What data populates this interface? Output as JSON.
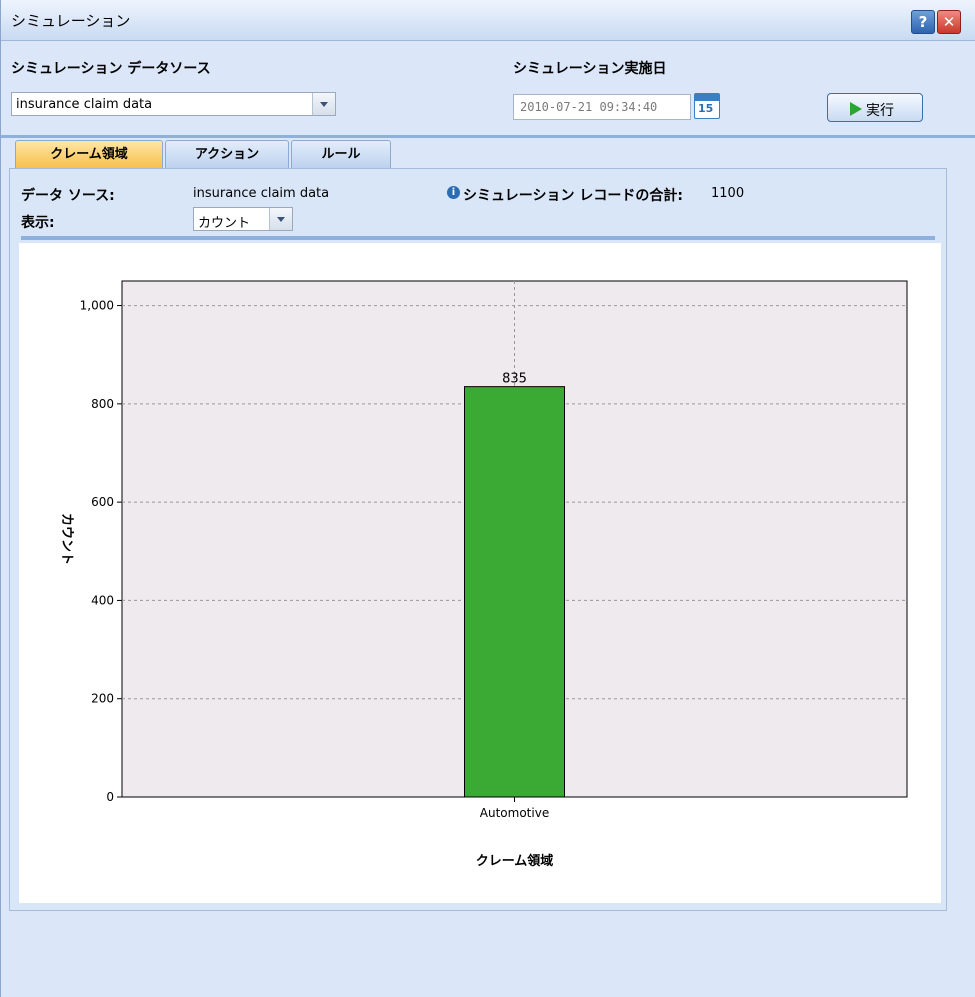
{
  "window": {
    "title": "シミュレーション",
    "help_label": "?",
    "close_label": "✕"
  },
  "datasource_section": {
    "label": "シミュレーション データソース",
    "selected": "insurance claim data"
  },
  "run_date_section": {
    "label": "シミュレーション実施日",
    "value": "2010-07-21 09:34:40",
    "calendar_day": "15"
  },
  "run_button": {
    "label": "実行"
  },
  "tabs": [
    {
      "label": "クレーム領域",
      "active": true
    },
    {
      "label": "アクション",
      "active": false
    },
    {
      "label": "ルール",
      "active": false
    }
  ],
  "panel": {
    "datasource_label": "データ ソース:",
    "datasource_value": "insurance claim data",
    "total_label": "シミュレーション レコードの合計:",
    "total_value": "1100",
    "display_label": "表示:",
    "display_selected": "カウント"
  },
  "colors": {
    "bar": "#3aaa35",
    "plot_bg": "#eeeaee",
    "accent": "#3c7dc4"
  },
  "chart_data": {
    "type": "bar",
    "categories": [
      "Automotive"
    ],
    "values": [
      835
    ],
    "data_labels": [
      "835"
    ],
    "xlabel": "クレーム領域",
    "ylabel": "カウント",
    "ylim": [
      0,
      1050
    ],
    "yticks": [
      0,
      200,
      400,
      600,
      800,
      1000
    ],
    "ytick_labels": [
      "0",
      "200",
      "400",
      "600",
      "800",
      "1,000"
    ],
    "grid": true
  }
}
